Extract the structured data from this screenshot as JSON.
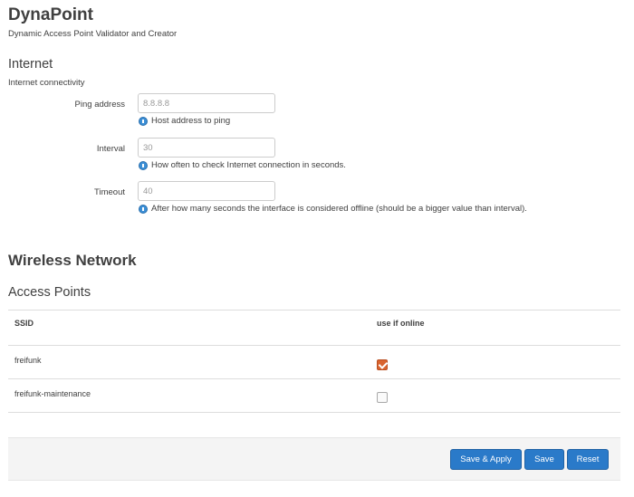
{
  "header": {
    "title": "DynaPoint",
    "subtitle": "Dynamic Access Point Validator and Creator"
  },
  "internet": {
    "title": "Internet",
    "description": "Internet connectivity",
    "fields": [
      {
        "label": "Ping address",
        "value": "8.8.8.8",
        "hint": "Host address to ping"
      },
      {
        "label": "Interval",
        "value": "30",
        "hint": "How often to check Internet connection in seconds."
      },
      {
        "label": "Timeout",
        "value": "40",
        "hint": "After how many seconds the interface is considered offline (should be a bigger value than interval)."
      }
    ]
  },
  "wireless": {
    "title": "Wireless Network",
    "access_points": {
      "title": "Access Points",
      "columns": [
        "SSID",
        "use if online"
      ],
      "rows": [
        {
          "ssid": "freifunk",
          "use_if_online": true
        },
        {
          "ssid": "freifunk-maintenance",
          "use_if_online": false
        }
      ]
    }
  },
  "actions": {
    "save_apply": "Save & Apply",
    "save": "Save",
    "reset": "Reset"
  },
  "colors": {
    "button_primary": "#2a7ac9",
    "checkbox_checked": "#d9642f",
    "info_icon": "#3b8fd6"
  }
}
